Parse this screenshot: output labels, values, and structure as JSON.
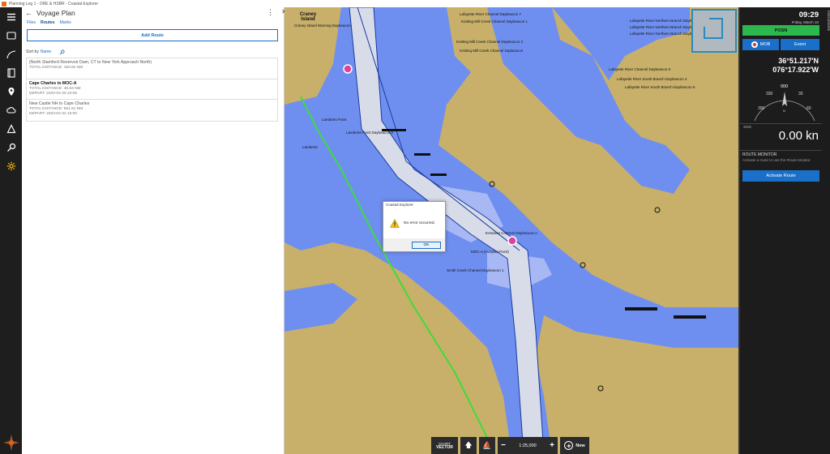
{
  "window": {
    "title": "Planning Leg 1 - ORE & HSBR - Coastal Explorer"
  },
  "rail": {
    "items": [
      {
        "name": "menu-icon"
      },
      {
        "name": "chart-icon"
      },
      {
        "name": "route-icon"
      },
      {
        "name": "book-icon"
      },
      {
        "name": "marker-icon"
      },
      {
        "name": "weather-icon"
      },
      {
        "name": "triangle-icon"
      },
      {
        "name": "search-icon"
      },
      {
        "name": "gear-icon"
      }
    ]
  },
  "panel": {
    "title": "Voyage Plan",
    "tabs": [
      "Files",
      "Routes",
      "Marks"
    ],
    "active_tab": "Routes",
    "add_route_label": "Add Route",
    "sort_label": "Sort by",
    "sort_value": "Name",
    "routes": [
      {
        "name": "(North Stamford Reservoir Dam, CT to New York Approach North)",
        "distance": "TOTAL DISTANCE: 150.84 NM",
        "depart": "",
        "bold": false
      },
      {
        "name": "Cape Charles to MOC-A",
        "distance": "TOTAL DISTANCE: 48.83 NM",
        "depart": "DEPART: 2023-02-26 23:05",
        "bold": true
      },
      {
        "name": "New Castle NH to Cape Charles",
        "distance": "TOTAL DISTANCE: 561.91 NM",
        "depart": "DEPART: 2023-02-22 15:00",
        "bold": false
      }
    ]
  },
  "chart": {
    "place_name": "Craney Island",
    "labels": [
      "Lafayette River Channel Daybeacon 7",
      "Knitting Mill Creek Channel Daybeacon 1",
      "Lafayette River Northern Branch Daybeacon 3",
      "Lafayette River Northern Branch Daybeacon 1",
      "Lafayette River Northern Branch Daybeacon 2",
      "Knitting Mill Creek Channel Daybeacon 3",
      "Knitting Mill Creek Channel Daybeacon",
      "Lafayette River Channel Daybeacon 9",
      "Lafayette River South Branch Daybeacon 4",
      "Lafayette River South Branch Daybeacon 6",
      "Lamberts Point",
      "Lamberts Point Daybeacon A",
      "Lamberts",
      "MOC-A (Hospital Point)",
      "Smith Creek Channel Daybeacon 1",
      "Entrance Channel Daybeacon A",
      "Craney Island Warning Daybeacon"
    ]
  },
  "dialog": {
    "title": "Coastal Explorer",
    "message": "No error occurred.",
    "ok_label": "OK"
  },
  "toolbar": {
    "chart_label": "CHART",
    "chart_mode": "VECTOR",
    "scale": "1:25,000",
    "new_label": "New"
  },
  "instruments": {
    "tab_label": "Instruments",
    "time": "09:29",
    "date": "Friday, March 10",
    "posn_label": "POSN",
    "mob_label": "MOB",
    "event_label": "Event",
    "latitude": "36°51.217'N",
    "longitude": "076°17.922'W",
    "compass_heading": "000",
    "compass_ticks": [
      "300",
      "330",
      "000",
      "30",
      "60"
    ],
    "sog_label": "SOG",
    "sog_value": "0.00 kn",
    "route_monitor_title": "ROUTE MONITOR",
    "route_monitor_desc": "Activate a route to use the Route Monitor.",
    "activate_label": "Activate Route"
  },
  "colors": {
    "accent": "#1a6fc9",
    "posn_green": "#2db84e",
    "land": "#c8b06a",
    "water": "#6f8ff0",
    "route_line": "#3ddc3d"
  }
}
